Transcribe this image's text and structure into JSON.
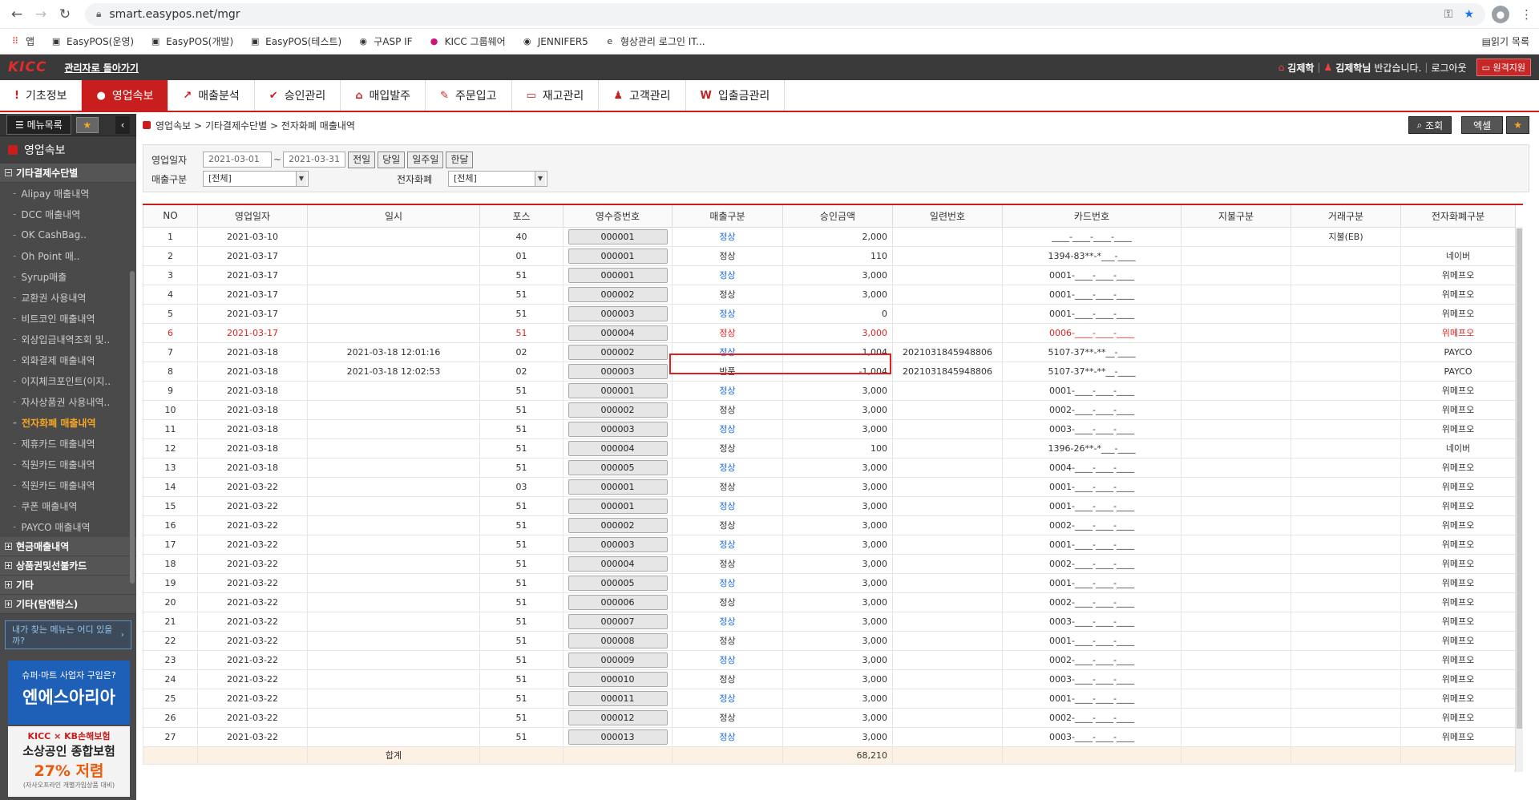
{
  "browser": {
    "url": "smart.easypos.net/mgr"
  },
  "bookmarks": [
    {
      "icon": "apps-icon",
      "label": "앱"
    },
    {
      "icon": "easypos-icon",
      "label": "EasyPOS(운영)"
    },
    {
      "icon": "easypos-icon",
      "label": "EasyPOS(개발)"
    },
    {
      "icon": "easypos-icon",
      "label": "EasyPOS(테스트)"
    },
    {
      "icon": "globe-icon",
      "label": "구ASP IF"
    },
    {
      "icon": "kicc-icon",
      "label": "KICC 그룹웨어"
    },
    {
      "icon": "globe-icon",
      "label": "JENNIFER5"
    },
    {
      "icon": "e-icon",
      "label": "형상관리 로그인 IT..."
    }
  ],
  "reading_list": "읽기 목록",
  "topbar": {
    "logo": "KICC",
    "admin_back": "관리자로 돌아가기",
    "store": "김제학",
    "user": "김제학님",
    "greeting": "반갑습니다.",
    "logout": "로그아웃",
    "remote": "원격지원"
  },
  "menu": [
    {
      "icon": "!",
      "label": "기초정보"
    },
    {
      "icon": "●",
      "label": "영업속보"
    },
    {
      "icon": "↗",
      "label": "매출분석"
    },
    {
      "icon": "✔",
      "label": "승인관리"
    },
    {
      "icon": "⌂",
      "label": "매입발주"
    },
    {
      "icon": "✎",
      "label": "주문입고"
    },
    {
      "icon": "▭",
      "label": "재고관리"
    },
    {
      "icon": "♟",
      "label": "고객관리"
    },
    {
      "icon": "W",
      "label": "입출금관리"
    }
  ],
  "sidebar": {
    "menu_list": "메뉴목록",
    "title": "영업속보",
    "group_open": "기타결제수단별",
    "items": [
      "Alipay 매출내역",
      "DCC 매출내역",
      "OK CashBag..",
      "Oh Point 매..",
      "Syrup매출",
      "교환권 사용내역",
      "비트코인 매출내역",
      "외상입금내역조회 및..",
      "외화결제 매출내역",
      "이지체크포인트(이지..",
      "자사상품권 사용내역..",
      "전자화폐 매출내역",
      "제휴카드 매출내역",
      "직원카드 매출내역",
      "직원카드 매출내역",
      "쿠폰 매출내역",
      "PAYCO 매출내역"
    ],
    "groups": [
      "현금매출내역",
      "상품권및선불카드",
      "기타",
      "기타(탐앤탐스)"
    ],
    "find": "내가 찾는 메뉴는 어디 있을까?",
    "ad1": {
      "l1": "슈퍼·마트 사업자 구입은?",
      "l2": "엔에스아리아"
    },
    "ad2": {
      "brand": "KICC × KB손해보험",
      "l1": "소상공인 종합보험",
      "l2": "27% 저렴",
      "l3": "(자사오프라인 개별가입상품 대비)"
    }
  },
  "breadcrumb": "영업속보 > 기타결제수단별 > 전자화폐 매출내역",
  "actions": {
    "search": "조회",
    "excel": "엑셀"
  },
  "filter": {
    "date_label": "영업일자",
    "date_from": "2021-03-01",
    "date_to": "2021-03-31",
    "btn_prev": "전일",
    "btn_today": "당일",
    "btn_week": "일주일",
    "btn_month": "한달",
    "sale_label": "매출구분",
    "sale_value": "[전체]",
    "emoney_label": "전자화폐",
    "emoney_value": "[전체]"
  },
  "table": {
    "columns": [
      "NO",
      "영업일자",
      "일시",
      "포스",
      "영수증번호",
      "매출구분",
      "승인금액",
      "일련번호",
      "카드번호",
      "지불구분",
      "거래구분",
      "전자화폐구분"
    ],
    "rows": [
      [
        "1",
        "2021-03-10",
        "",
        "40",
        "000001",
        "정상",
        "2,000",
        "",
        "____-____-____-____",
        "",
        "지불(EB)",
        ""
      ],
      [
        "2",
        "2021-03-17",
        "",
        "01",
        "000001",
        "정상",
        "110",
        "",
        "1394-83**-*___-____",
        "",
        "",
        "네이버"
      ],
      [
        "3",
        "2021-03-17",
        "",
        "51",
        "000001",
        "정상",
        "3,000",
        "",
        "0001-____-____-____",
        "",
        "",
        "위메프오"
      ],
      [
        "4",
        "2021-03-17",
        "",
        "51",
        "000002",
        "정상",
        "3,000",
        "",
        "0001-____-____-____",
        "",
        "",
        "위메프오"
      ],
      [
        "5",
        "2021-03-17",
        "",
        "51",
        "000003",
        "정상",
        "0",
        "",
        "0001-____-____-____",
        "",
        "",
        "위메프오"
      ],
      [
        "6",
        "2021-03-17",
        "",
        "51",
        "000004",
        "정상",
        "3,000",
        "",
        "0006-____-____-____",
        "",
        "",
        "위메프오"
      ],
      [
        "7",
        "2021-03-18",
        "2021-03-18  12:01:16",
        "02",
        "000002",
        "정상",
        "1,004",
        "2021031845948806",
        "5107-37**-**__-____",
        "",
        "",
        "PAYCO"
      ],
      [
        "8",
        "2021-03-18",
        "2021-03-18  12:02:53",
        "02",
        "000003",
        "반품",
        "-1,004",
        "2021031845948806",
        "5107-37**-**__-____",
        "",
        "",
        "PAYCO"
      ],
      [
        "9",
        "2021-03-18",
        "",
        "51",
        "000001",
        "정상",
        "3,000",
        "",
        "0001-____-____-____",
        "",
        "",
        "위메프오"
      ],
      [
        "10",
        "2021-03-18",
        "",
        "51",
        "000002",
        "정상",
        "3,000",
        "",
        "0002-____-____-____",
        "",
        "",
        "위메프오"
      ],
      [
        "11",
        "2021-03-18",
        "",
        "51",
        "000003",
        "정상",
        "3,000",
        "",
        "0003-____-____-____",
        "",
        "",
        "위메프오"
      ],
      [
        "12",
        "2021-03-18",
        "",
        "51",
        "000004",
        "정상",
        "100",
        "",
        "1396-26**-*___-____",
        "",
        "",
        "네이버"
      ],
      [
        "13",
        "2021-03-18",
        "",
        "51",
        "000005",
        "정상",
        "3,000",
        "",
        "0004-____-____-____",
        "",
        "",
        "위메프오"
      ],
      [
        "14",
        "2021-03-22",
        "",
        "03",
        "000001",
        "정상",
        "3,000",
        "",
        "0001-____-____-____",
        "",
        "",
        "위메프오"
      ],
      [
        "15",
        "2021-03-22",
        "",
        "51",
        "000001",
        "정상",
        "3,000",
        "",
        "0001-____-____-____",
        "",
        "",
        "위메프오"
      ],
      [
        "16",
        "2021-03-22",
        "",
        "51",
        "000002",
        "정상",
        "3,000",
        "",
        "0002-____-____-____",
        "",
        "",
        "위메프오"
      ],
      [
        "17",
        "2021-03-22",
        "",
        "51",
        "000003",
        "정상",
        "3,000",
        "",
        "0001-____-____-____",
        "",
        "",
        "위메프오"
      ],
      [
        "18",
        "2021-03-22",
        "",
        "51",
        "000004",
        "정상",
        "3,000",
        "",
        "0002-____-____-____",
        "",
        "",
        "위메프오"
      ],
      [
        "19",
        "2021-03-22",
        "",
        "51",
        "000005",
        "정상",
        "3,000",
        "",
        "0001-____-____-____",
        "",
        "",
        "위메프오"
      ],
      [
        "20",
        "2021-03-22",
        "",
        "51",
        "000006",
        "정상",
        "3,000",
        "",
        "0002-____-____-____",
        "",
        "",
        "위메프오"
      ],
      [
        "21",
        "2021-03-22",
        "",
        "51",
        "000007",
        "정상",
        "3,000",
        "",
        "0003-____-____-____",
        "",
        "",
        "위메프오"
      ],
      [
        "22",
        "2021-03-22",
        "",
        "51",
        "000008",
        "정상",
        "3,000",
        "",
        "0001-____-____-____",
        "",
        "",
        "위메프오"
      ],
      [
        "23",
        "2021-03-22",
        "",
        "51",
        "000009",
        "정상",
        "3,000",
        "",
        "0002-____-____-____",
        "",
        "",
        "위메프오"
      ],
      [
        "24",
        "2021-03-22",
        "",
        "51",
        "000010",
        "정상",
        "3,000",
        "",
        "0003-____-____-____",
        "",
        "",
        "위메프오"
      ],
      [
        "25",
        "2021-03-22",
        "",
        "51",
        "000011",
        "정상",
        "3,000",
        "",
        "0001-____-____-____",
        "",
        "",
        "위메프오"
      ],
      [
        "26",
        "2021-03-22",
        "",
        "51",
        "000012",
        "정상",
        "3,000",
        "",
        "0002-____-____-____",
        "",
        "",
        "위메프오"
      ],
      [
        "27",
        "2021-03-22",
        "",
        "51",
        "000013",
        "정상",
        "3,000",
        "",
        "0003-____-____-____",
        "",
        "",
        "위메프오"
      ]
    ],
    "blue_status_rows": [
      1,
      3,
      5,
      6,
      7,
      9,
      11,
      13,
      15,
      17,
      19,
      21,
      23,
      25,
      27
    ],
    "red_row": 6,
    "sum_label": "합계",
    "sum_value": "68,210"
  }
}
